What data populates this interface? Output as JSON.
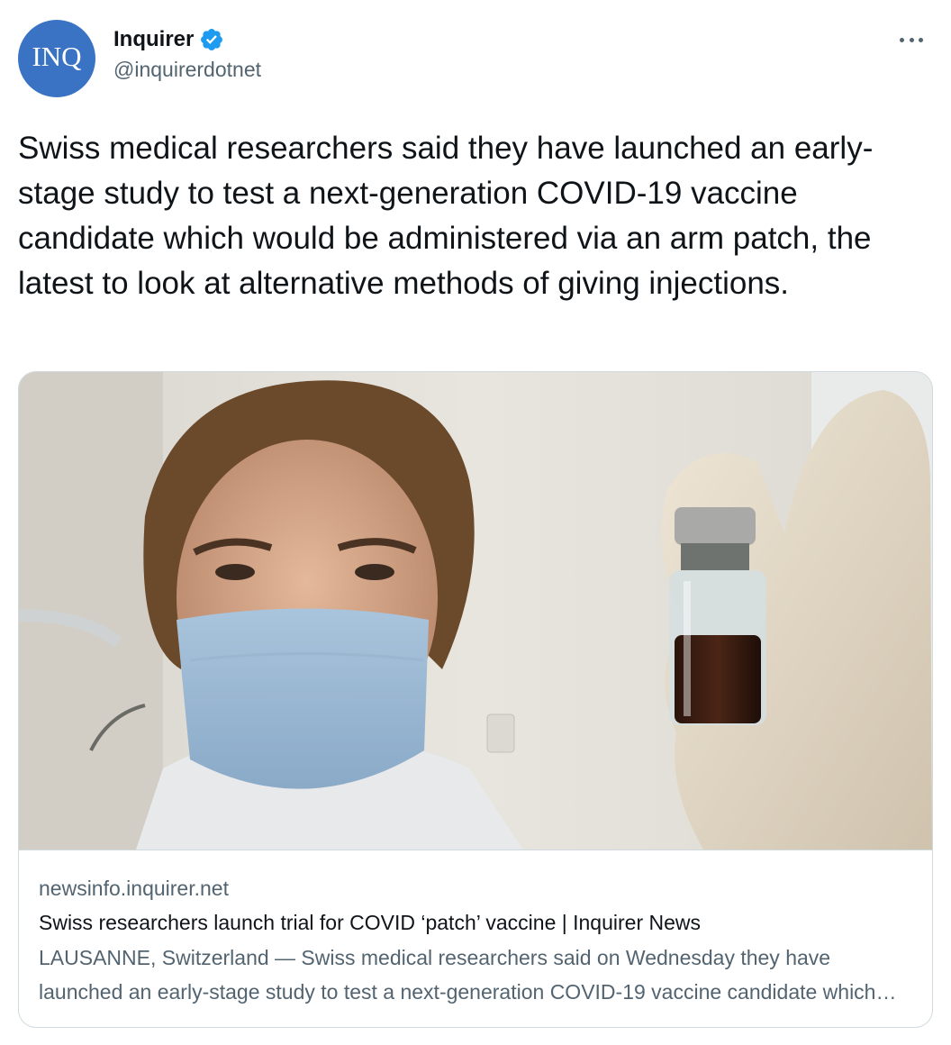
{
  "author": {
    "avatar_text": "INQ",
    "display_name": "Inquirer",
    "verified": true,
    "handle": "@inquirerdotnet"
  },
  "tweet": {
    "text": "Swiss medical researchers said they have launched an early-stage study to test a next-generation COVID-19 vaccine candidate which would be administered via an arm patch, the latest to look at alternative methods of giving injections."
  },
  "card": {
    "image_icon": "photo-researcher-holding-vaccine-vial",
    "domain": "newsinfo.inquirer.net",
    "title": "Swiss researchers launch trial for COVID ‘patch’ vaccine | Inquirer News",
    "description": "LAUSANNE, Switzerland — Swiss medical researchers said on Wednesday they have launched an early-stage study to test a next-generation COVID-19 vaccine candidate which would be administered via an arm patch"
  },
  "icons": {
    "more": "more-horizontal-icon",
    "verified": "verified-badge-icon"
  },
  "colors": {
    "avatar_bg": "#3a73c4",
    "verified_blue": "#1d9bf0",
    "text_primary": "#0f1419",
    "text_secondary": "#536471",
    "border": "#cfd9de"
  }
}
